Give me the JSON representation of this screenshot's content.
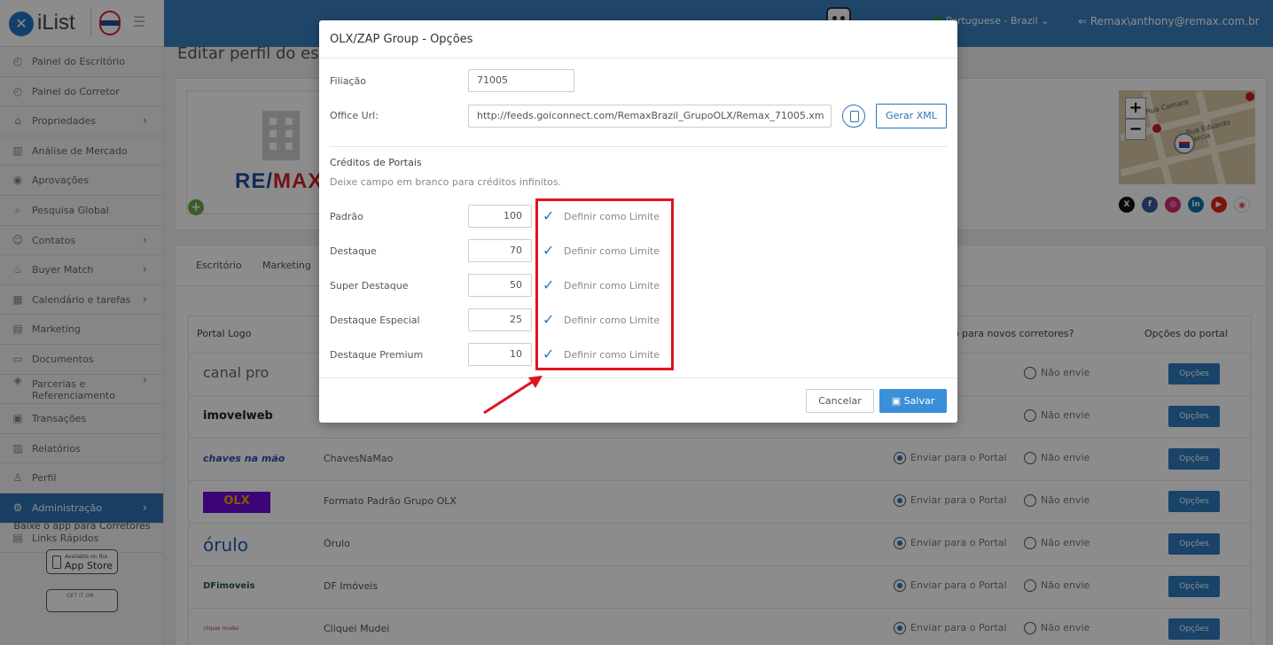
{
  "header": {
    "logo_text": "iList",
    "language": "Portuguese - Brazil",
    "user": "Remax\\anthony@remax.com.br"
  },
  "sidebar": {
    "items": [
      {
        "label": "Painel do Escritório",
        "icon": "dashboard-icon",
        "chevron": false
      },
      {
        "label": "Painel do Corretor",
        "icon": "dashboard-icon",
        "chevron": false
      },
      {
        "label": "Propriedades",
        "icon": "home-icon",
        "chevron": true
      },
      {
        "label": "Análise de Mercado",
        "icon": "chart-icon",
        "chevron": false
      },
      {
        "label": "Aprovações",
        "icon": "eye-icon",
        "chevron": false
      },
      {
        "label": "Pesquisa Global",
        "icon": "search-icon",
        "chevron": false
      },
      {
        "label": "Contatos",
        "icon": "contacts-icon",
        "chevron": true
      },
      {
        "label": "Buyer Match",
        "icon": "fire-icon",
        "chevron": true
      },
      {
        "label": "Calendário e tarefas",
        "icon": "calendar-icon",
        "chevron": true
      },
      {
        "label": "Marketing",
        "icon": "newspaper-icon",
        "chevron": false
      },
      {
        "label": "Documentos",
        "icon": "folder-icon",
        "chevron": false
      },
      {
        "label": "Parcerias e Referenciamento",
        "icon": "tag-icon",
        "chevron": true
      },
      {
        "label": "Transações",
        "icon": "briefcase-icon",
        "chevron": false
      },
      {
        "label": "Relatórios",
        "icon": "chart-icon",
        "chevron": false
      },
      {
        "label": "Perfil",
        "icon": "user-icon",
        "chevron": false
      },
      {
        "label": "Administração",
        "icon": "gear-icon",
        "chevron": true,
        "active": true
      },
      {
        "label": "Links Rápidos",
        "icon": "links-icon",
        "chevron": false
      }
    ],
    "app_title": "Baixe o app para Corretores",
    "appstore_small": "Available on the",
    "appstore_big": "App Store",
    "playstore_small": "GET IT ON"
  },
  "page": {
    "title": "Editar perfil do esc",
    "remax_logo_left": "RE/",
    "remax_logo_right": "MAX",
    "map_street1": "Rua Eduardo Garcia",
    "map_street2": "Rua Camara",
    "tabs": [
      "Escritório",
      "Marketing"
    ],
    "table": {
      "col_logo": "Portal Logo",
      "col_send": "ão para novos corretores?",
      "col_options": "Opções do portal",
      "rows": [
        {
          "logo": "canal pro",
          "name": "",
          "send_label": "a o Portal",
          "no_send_label": "Não envie",
          "options": "Opções"
        },
        {
          "logo": "imovelweb",
          "name": "",
          "send_label": "a o Portal",
          "no_send_label": "Não envie",
          "options": "Opções"
        },
        {
          "logo": "chaves na mão",
          "name": "ChavesNaMao",
          "send_label": "Enviar para o Portal",
          "no_send_label": "Não envie",
          "options": "Opções"
        },
        {
          "logo": "OLX",
          "name": "Formato Padrão Grupo OLX",
          "send_label": "Enviar para o Portal",
          "no_send_label": "Não envie",
          "options": "Opções"
        },
        {
          "logo": "órulo",
          "name": "Órulo",
          "send_label": "Enviar para o Portal",
          "no_send_label": "Não envie",
          "options": "Opções"
        },
        {
          "logo": "DFimoveis",
          "name": "DF Imóveis",
          "send_label": "Enviar para o Portal",
          "no_send_label": "Não envie",
          "options": "Opções"
        },
        {
          "logo": "cliquei mudei",
          "name": "Cliquei Mudei",
          "send_label": "Enviar para o Portal",
          "no_send_label": "Não envie",
          "options": "Opções"
        }
      ]
    }
  },
  "modal": {
    "title": "OLX/ZAP Group - Opções",
    "filiacao_label": "Filiação",
    "filiacao_value": "71005",
    "office_url_label": "Office Url:",
    "office_url_value": "http://feeds.goiconnect.com/RemaxBrazil_GrupoOLX/Remax_71005.xm",
    "gerar_xml": "Gerar XML",
    "section_title": "Créditos de Portais",
    "section_hint": "Deixe campo em branco para créditos infinitos.",
    "credits": [
      {
        "label": "Padrão",
        "value": "100",
        "check_label": "Definir como Limite"
      },
      {
        "label": "Destaque",
        "value": "70",
        "check_label": "Definir como Limite"
      },
      {
        "label": "Super Destaque",
        "value": "50",
        "check_label": "Definir como Limite"
      },
      {
        "label": "Destaque Especial",
        "value": "25",
        "check_label": "Definir como Limite"
      },
      {
        "label": "Destaque Premium",
        "value": "10",
        "check_label": "Definir como Limite"
      }
    ],
    "cancel": "Cancelar",
    "save": "Salvar"
  },
  "colors": {
    "primary": "#2f74b5",
    "highlight": "#e0141e",
    "header": "#3a80c0"
  }
}
